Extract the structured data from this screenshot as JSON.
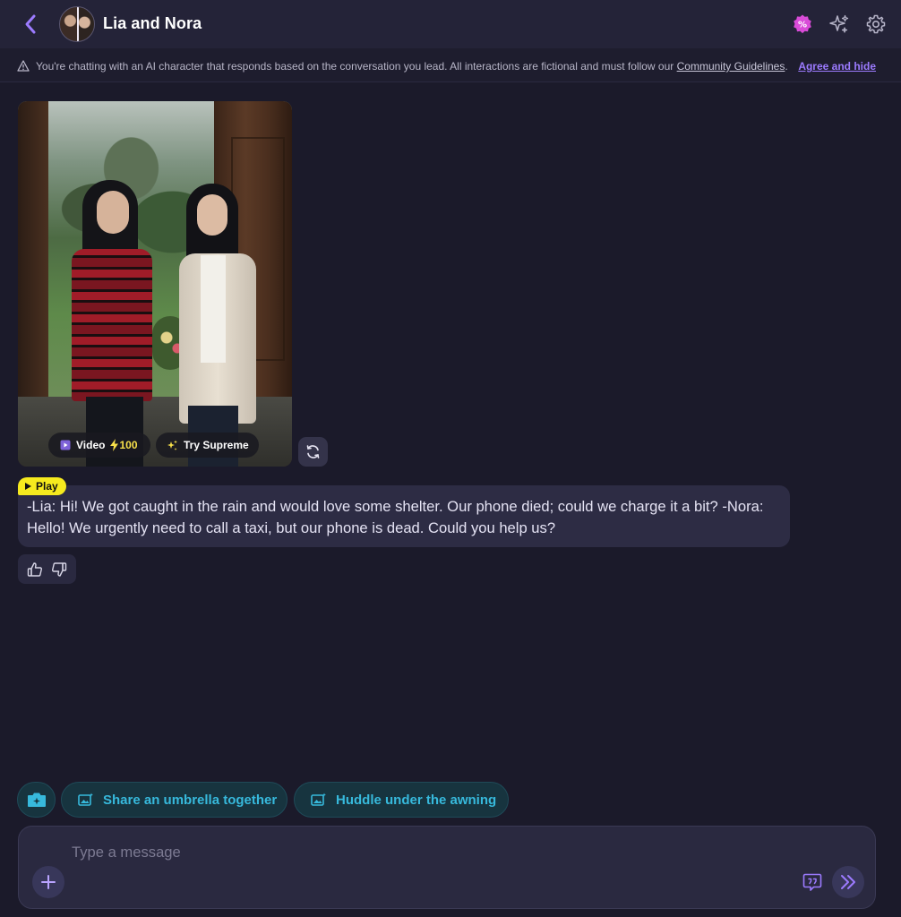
{
  "header": {
    "title": "Lia and Nora",
    "back_icon": "chevron-left-icon",
    "icons": [
      "discount-badge-icon",
      "sparkles-icon",
      "gear-icon"
    ]
  },
  "notice": {
    "text": "You're chatting with an AI character that responds based on the conversation you lead. All interactions are fictional and must follow our",
    "link": "Community Guidelines",
    "suffix": ".",
    "action": "Agree and hide"
  },
  "image_card": {
    "video_label": "Video",
    "video_cost": "100",
    "supreme_label": "Try Supreme"
  },
  "message": {
    "play_label": "Play",
    "text": "-Lia: Hi! We got caught in the rain and would love some shelter. Our phone died; could we charge it a bit? -Nora: Hello! We urgently need to call a taxi, but our phone is dead. Could you help us?"
  },
  "suggestions": [
    {
      "label": "Share an umbrella together"
    },
    {
      "label": "Huddle under the awning"
    }
  ],
  "composer": {
    "placeholder": "Type a message"
  },
  "colors": {
    "background": "#1b1a2a",
    "header": "#242338",
    "accent_purple": "#9c7bff",
    "play_yellow": "#f6ea1e",
    "suggestion_teal": "#37b9dc",
    "badge_pink": "#d94bd8"
  }
}
